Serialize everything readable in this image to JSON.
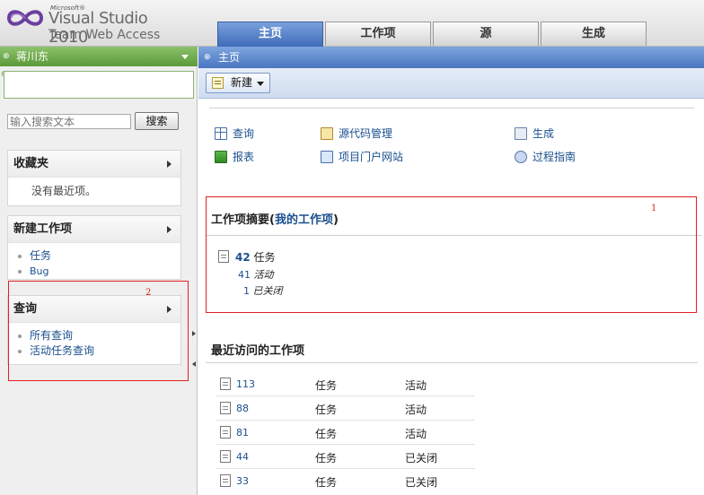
{
  "header": {
    "logo_ms": "Microsoft®",
    "logo_product": "Visual Studio 2010",
    "logo_sub": "Team Web Access",
    "tabs": [
      {
        "label": "主页",
        "active": true
      },
      {
        "label": "工作项",
        "active": false
      },
      {
        "label": "源",
        "active": false
      },
      {
        "label": "生成",
        "active": false
      }
    ]
  },
  "sidebar": {
    "user_name": "蒋川东",
    "search": {
      "placeholder": "输入搜索文本",
      "button": "搜索"
    },
    "favorites": {
      "title": "收藏夹",
      "empty": "没有最近项。"
    },
    "new_work_item": {
      "title": "新建工作项",
      "items": [
        "任务",
        "Bug"
      ]
    },
    "queries": {
      "title": "查询",
      "items": [
        "所有查询",
        "活动任务查询"
      ]
    }
  },
  "main": {
    "breadcrumb": "主页",
    "new_button": "新建",
    "quick_links": {
      "query": "查询",
      "report": "报表",
      "source_control": "源代码管理",
      "project_portal": "项目门户网站",
      "build": "生成",
      "process_guidance": "过程指南"
    },
    "summary": {
      "title_prefix": "工作项摘要(",
      "title_link": "我的工作项",
      "title_suffix": ")",
      "total_count": "42",
      "total_label": "任务",
      "active_count": "41",
      "active_label": "活动",
      "closed_count": "1",
      "closed_label": "已关闭"
    },
    "recent": {
      "title": "最近访问的工作项",
      "rows": [
        {
          "id": "113",
          "type": "任务",
          "state": "活动"
        },
        {
          "id": "88",
          "type": "任务",
          "state": "活动"
        },
        {
          "id": "81",
          "type": "任务",
          "state": "活动"
        },
        {
          "id": "44",
          "type": "任务",
          "state": "已关闭"
        },
        {
          "id": "33",
          "type": "任务",
          "state": "已关闭"
        }
      ]
    }
  },
  "annotations": {
    "box1": "1",
    "box2": "2"
  },
  "colors": {
    "accent_blue": "#4a76c0",
    "user_green": "#5c9a3a",
    "annotation_red": "#e02020",
    "link": "#1a4f8e"
  }
}
